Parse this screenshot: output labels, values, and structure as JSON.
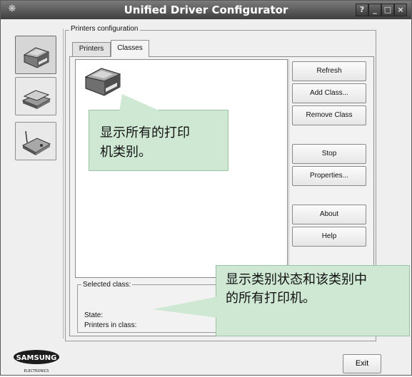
{
  "window": {
    "title": "Unified Driver Configurator",
    "title_buttons": [
      "?",
      "_",
      "□",
      "×"
    ]
  },
  "sidebar": {
    "items": [
      {
        "name": "printers",
        "icon": "printer-icon",
        "selected": true
      },
      {
        "name": "scanners",
        "icon": "scanner-icon",
        "selected": false
      },
      {
        "name": "ports",
        "icon": "port-icon",
        "selected": false
      }
    ]
  },
  "group": {
    "legend": "Printers configuration"
  },
  "tabs": [
    {
      "label": "Printers"
    },
    {
      "label": "Classes",
      "active": true
    }
  ],
  "actions": {
    "refresh": "Refresh",
    "add_class": "Add Class...",
    "remove_class": "Remove Class",
    "stop": "Stop",
    "properties": "Properties...",
    "about": "About",
    "help": "Help"
  },
  "selected_class": {
    "legend": "Selected class:",
    "state_label": "State:",
    "printers_label": "Printers in class:"
  },
  "callouts": {
    "one_line1": "显示所有的打印",
    "one_line2": "机类别。",
    "two_line1": "显示类别状态和该类别中",
    "two_line2": "的所有打印机。"
  },
  "footer": {
    "exit": "Exit",
    "logo_brand": "SAMSUNG",
    "logo_sub": "ELECTRONICS"
  },
  "colors": {
    "callout_bg": "#cfe8d4",
    "titlebar": "#4a4a4a"
  }
}
